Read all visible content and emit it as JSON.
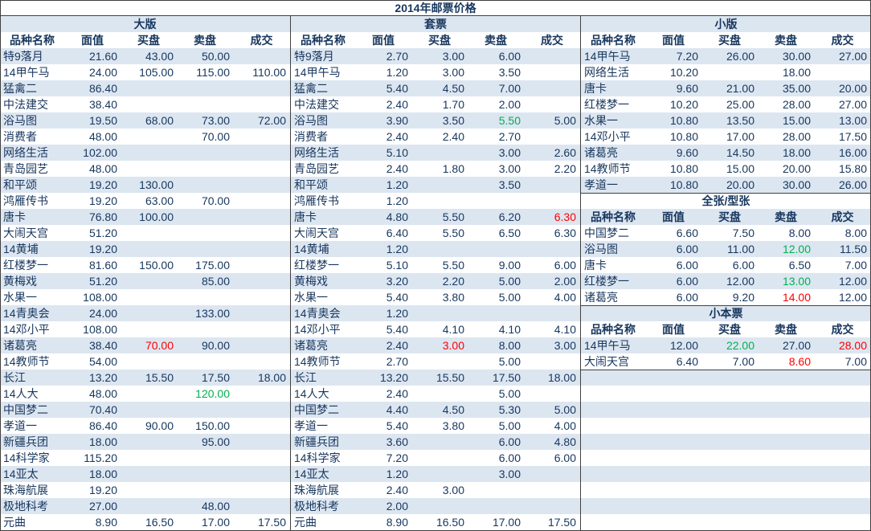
{
  "title": "2014年邮票价格",
  "columns": [
    "品种名称",
    "面值",
    "买盘",
    "卖盘",
    "成交"
  ],
  "colors": {
    "text": "#17365d",
    "row_shade": "#dce6f1",
    "border": "#404040",
    "highlight_red": "#ff0000",
    "highlight_green": "#00b050"
  },
  "daban": {
    "title": "大版",
    "rows": [
      [
        "特9落月",
        "21.60",
        "43.00",
        "50.00",
        ""
      ],
      [
        "14甲午马",
        "24.00",
        "105.00",
        "115.00",
        "110.00"
      ],
      [
        "猛禽二",
        "86.40",
        "",
        "",
        ""
      ],
      [
        "中法建交",
        "38.40",
        "",
        "",
        ""
      ],
      [
        "浴马图",
        "19.50",
        "68.00",
        "73.00",
        "72.00"
      ],
      [
        "消费者",
        "48.00",
        "",
        "70.00",
        ""
      ],
      [
        "网络生活",
        "102.00",
        "",
        "",
        ""
      ],
      [
        "青岛园艺",
        "48.00",
        "",
        "",
        ""
      ],
      [
        "和平颂",
        "19.20",
        "130.00",
        "",
        ""
      ],
      [
        "鸿雁传书",
        "19.20",
        "63.00",
        "70.00",
        ""
      ],
      [
        "唐卡",
        "76.80",
        "100.00",
        "",
        ""
      ],
      [
        "大闹天宫",
        "51.20",
        "",
        "",
        ""
      ],
      [
        "14黄埔",
        "19.20",
        "",
        "",
        ""
      ],
      [
        "红楼梦一",
        "81.60",
        "150.00",
        "175.00",
        ""
      ],
      [
        "黄梅戏",
        "51.20",
        "",
        "85.00",
        ""
      ],
      [
        "水果一",
        "108.00",
        "",
        "",
        ""
      ],
      [
        "14青奥会",
        "24.00",
        "",
        "133.00",
        ""
      ],
      [
        "14邓小平",
        "108.00",
        "",
        "",
        ""
      ],
      [
        "诸葛亮",
        "38.40",
        {
          "v": "70.00",
          "color": "#ff0000"
        },
        "90.00",
        ""
      ],
      [
        "14教师节",
        "54.00",
        "",
        "",
        ""
      ],
      [
        "长江",
        "13.20",
        "15.50",
        "17.50",
        "18.00"
      ],
      [
        "14人大",
        "48.00",
        "",
        {
          "v": "120.00",
          "color": "#00b050"
        },
        ""
      ],
      [
        "中国梦二",
        "70.40",
        "",
        "",
        ""
      ],
      [
        "孝道一",
        "86.40",
        "90.00",
        "150.00",
        ""
      ],
      [
        "新疆兵团",
        "18.00",
        "",
        "95.00",
        ""
      ],
      [
        "14科学家",
        "115.20",
        "",
        "",
        ""
      ],
      [
        "14亚太",
        "18.00",
        "",
        "",
        ""
      ],
      [
        "珠海航展",
        "19.20",
        "",
        "",
        ""
      ],
      [
        "极地科考",
        "27.00",
        "",
        "48.00",
        ""
      ],
      [
        "元曲",
        "8.90",
        "16.50",
        "17.00",
        "17.50"
      ]
    ]
  },
  "taopiao": {
    "title": "套票",
    "rows": [
      [
        "特9落月",
        "2.70",
        "3.00",
        "6.00",
        ""
      ],
      [
        "14甲午马",
        "1.20",
        "3.00",
        "3.50",
        ""
      ],
      [
        "猛禽二",
        "5.40",
        "4.50",
        "7.00",
        ""
      ],
      [
        "中法建交",
        "2.40",
        "1.70",
        "2.00",
        ""
      ],
      [
        "浴马图",
        "3.90",
        "3.50",
        {
          "v": "5.50",
          "color": "#00b050"
        },
        "5.00"
      ],
      [
        "消费者",
        "2.40",
        "2.40",
        "2.70",
        ""
      ],
      [
        "网络生活",
        "5.10",
        "",
        "3.00",
        "2.60"
      ],
      [
        "青岛园艺",
        "2.40",
        "1.80",
        "3.00",
        "2.20"
      ],
      [
        "和平颂",
        "1.20",
        "",
        "3.50",
        ""
      ],
      [
        "鸿雁传书",
        "1.20",
        "",
        "",
        ""
      ],
      [
        "唐卡",
        "4.80",
        "5.50",
        "6.20",
        {
          "v": "6.30",
          "color": "#ff0000"
        }
      ],
      [
        "大闹天宫",
        "6.40",
        "5.50",
        "6.50",
        "6.30"
      ],
      [
        "14黄埔",
        "1.20",
        "",
        "",
        ""
      ],
      [
        "红楼梦一",
        "5.10",
        "5.50",
        "9.00",
        "6.00"
      ],
      [
        "黄梅戏",
        "3.20",
        "2.20",
        "5.00",
        "2.00"
      ],
      [
        "水果一",
        "5.40",
        "3.80",
        "5.00",
        "4.00"
      ],
      [
        "14青奥会",
        "1.20",
        "",
        "",
        ""
      ],
      [
        "14邓小平",
        "5.40",
        "4.10",
        "4.10",
        "4.10"
      ],
      [
        "诸葛亮",
        "2.40",
        {
          "v": "3.00",
          "color": "#ff0000"
        },
        "8.00",
        "3.00"
      ],
      [
        "14教师节",
        "2.70",
        "",
        "5.00",
        ""
      ],
      [
        "长江",
        "13.20",
        "15.50",
        "17.50",
        "18.00"
      ],
      [
        "14人大",
        "2.40",
        "",
        "5.00",
        ""
      ],
      [
        "中国梦二",
        "4.40",
        "4.50",
        "5.30",
        "5.00"
      ],
      [
        "孝道一",
        "5.40",
        "3.80",
        "5.00",
        "4.00"
      ],
      [
        "新疆兵团",
        "3.60",
        "",
        "6.00",
        "4.80"
      ],
      [
        "14科学家",
        "7.20",
        "",
        "6.00",
        "6.00"
      ],
      [
        "14亚太",
        "1.20",
        "",
        "3.00",
        ""
      ],
      [
        "珠海航展",
        "2.40",
        "3.00",
        "",
        ""
      ],
      [
        "极地科考",
        "2.00",
        "",
        "",
        ""
      ],
      [
        "元曲",
        "8.90",
        "16.50",
        "17.00",
        "17.50"
      ]
    ]
  },
  "xiaoban": {
    "title": "小版",
    "rows": [
      [
        "14甲午马",
        "7.20",
        "26.00",
        "30.00",
        "27.00"
      ],
      [
        "网络生活",
        "10.20",
        "",
        "18.00",
        ""
      ],
      [
        "唐卡",
        "9.60",
        "21.00",
        "35.00",
        "20.00"
      ],
      [
        "红楼梦一",
        "10.20",
        "25.00",
        "28.00",
        "27.00"
      ],
      [
        "水果一",
        "10.80",
        "13.50",
        "15.00",
        "13.00"
      ],
      [
        "14邓小平",
        "10.80",
        "17.00",
        "28.00",
        "17.50"
      ],
      [
        "诸葛亮",
        "9.60",
        "14.50",
        "18.00",
        "16.00"
      ],
      [
        "14教师节",
        "10.80",
        "15.00",
        "20.00",
        "15.80"
      ],
      [
        "孝道一",
        "10.80",
        "20.00",
        "30.00",
        "26.00"
      ]
    ]
  },
  "quanzhang": {
    "title": "全张/型张",
    "rows": [
      [
        "中国梦二",
        "6.60",
        "7.50",
        "8.00",
        "8.00"
      ],
      [
        "浴马图",
        "6.00",
        "11.00",
        {
          "v": "12.00",
          "color": "#00b050"
        },
        "11.50"
      ],
      [
        "唐卡",
        "6.00",
        "6.00",
        "6.50",
        "7.00"
      ],
      [
        "红楼梦一",
        "6.00",
        "12.00",
        {
          "v": "13.00",
          "color": "#00b050"
        },
        "12.00"
      ],
      [
        "诸葛亮",
        "6.00",
        "9.20",
        {
          "v": "14.00",
          "color": "#ff0000"
        },
        "12.00"
      ]
    ]
  },
  "xiaobenpiao": {
    "title": "小本票",
    "rows": [
      [
        "14甲午马",
        "12.00",
        {
          "v": "22.00",
          "color": "#00b050"
        },
        "27.00",
        {
          "v": "28.00",
          "color": "#ff0000"
        }
      ],
      [
        "大闹天宫",
        "6.40",
        "7.00",
        {
          "v": "8.60",
          "color": "#ff0000"
        },
        "7.00"
      ]
    ]
  }
}
